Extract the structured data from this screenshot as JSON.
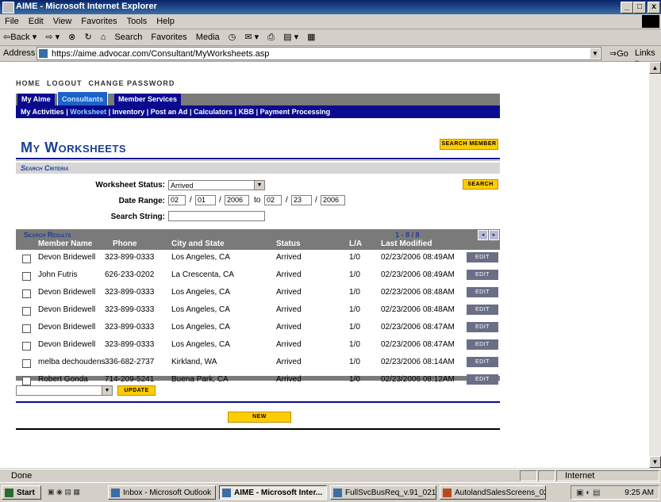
{
  "window": {
    "title": "AIME - Microsoft Internet Explorer",
    "min": "_",
    "max": "□",
    "close": "x"
  },
  "menu": [
    "File",
    "Edit",
    "View",
    "Favorites",
    "Tools",
    "Help"
  ],
  "toolbar": {
    "back": "⇦Back ▾",
    "forward": "⇨ ▾",
    "stop": "⊗",
    "refresh": "↻",
    "home": "⌂",
    "search": "Search",
    "favorites": "Favorites",
    "media": "Media",
    "history": "◷",
    "mail": "✉ ▾",
    "print": "⎙",
    "edit": "▤ ▾",
    "discuss": "▦"
  },
  "address": {
    "label": "Address",
    "url": "https://aime.advocar.com/Consultant/MyWorksheets.asp",
    "go": "⇒Go",
    "links": "Links »"
  },
  "site": {
    "topnav": [
      "HOME",
      "LOGOUT",
      "CHANGE PASSWORD"
    ],
    "tabs": [
      "My Aime",
      "Consultants",
      "Member Services"
    ],
    "active_tab": 1,
    "subnav": [
      "My Activities",
      "Worksheet",
      "Inventory",
      "Post an Ad",
      "Calculators",
      "KBB",
      "Payment Processing"
    ],
    "subnav_sep": "|",
    "active_subnav": 1,
    "page_title": "My Worksheets",
    "search_member_button": "SEARCH MEMBER"
  },
  "criteria": {
    "section_title": "Search Criteria",
    "status_label": "Worksheet Status:",
    "status_value": "Arrived",
    "date_label": "Date Range:",
    "from": {
      "month": "02",
      "day": "01",
      "year": "2006"
    },
    "to_label": "to",
    "to": {
      "month": "02",
      "day": "23",
      "year": "2006"
    },
    "slash": "/",
    "search_string_label": "Search String:",
    "search_string_value": "",
    "search_button": "SEARCH"
  },
  "results": {
    "section_title": "Search Results",
    "count": "1 - 8 / 8",
    "prev": "◂",
    "next": "▸",
    "columns": [
      "Member Name",
      "Phone",
      "City and State",
      "Status",
      "L/A",
      "Last Modified"
    ],
    "edit_label": "EDIT",
    "rows": [
      {
        "name": "Devon Bridewell",
        "phone": "323-899-0333",
        "city": "Los Angeles, CA",
        "status": "Arrived",
        "la": "1/0",
        "modified": "02/23/2006 08:49AM"
      },
      {
        "name": "John Futris",
        "phone": "626-233-0202",
        "city": "La Crescenta, CA",
        "status": "Arrived",
        "la": "1/0",
        "modified": "02/23/2006 08:49AM"
      },
      {
        "name": "Devon Bridewell",
        "phone": "323-899-0333",
        "city": "Los Angeles, CA",
        "status": "Arrived",
        "la": "1/0",
        "modified": "02/23/2006 08:48AM"
      },
      {
        "name": "Devon Bridewell",
        "phone": "323-899-0333",
        "city": "Los Angeles, CA",
        "status": "Arrived",
        "la": "1/0",
        "modified": "02/23/2006 08:48AM"
      },
      {
        "name": "Devon Bridewell",
        "phone": "323-899-0333",
        "city": "Los Angeles, CA",
        "status": "Arrived",
        "la": "1/0",
        "modified": "02/23/2006 08:47AM"
      },
      {
        "name": "Devon Bridewell",
        "phone": "323-899-0333",
        "city": "Los Angeles, CA",
        "status": "Arrived",
        "la": "1/0",
        "modified": "02/23/2006 08:47AM"
      },
      {
        "name": "melba dechoudens",
        "phone": "336-682-2737",
        "city": "Kirkland, WA",
        "status": "Arrived",
        "la": "1/0",
        "modified": "02/23/2006 08:14AM"
      },
      {
        "name": "Robert Gonda",
        "phone": "714-209-5241",
        "city": "Buena Park, CA",
        "status": "Arrived",
        "la": "1/0",
        "modified": "02/23/2006 08:12AM"
      }
    ],
    "bulk_select_value": "",
    "update_button": "UPDATE",
    "new_button": "NEW"
  },
  "status": {
    "text": "Done",
    "zone": "Internet"
  },
  "taskbar": {
    "start": "Start",
    "items": [
      "Inbox - Microsoft Outlook",
      "AIME - Microsoft Inter...",
      "FullSvcBusReq_v.91_021...",
      "AutolandSalesScreens_02..."
    ],
    "active_item": 1,
    "clock": "9:25 AM"
  },
  "colors": {
    "nav_blue": "#0b0b8f",
    "title_blue": "#1b3f94",
    "button_yellow": "#ffcc00",
    "header_gray": "#7a7a7a",
    "edit_button": "#6a6f86"
  }
}
